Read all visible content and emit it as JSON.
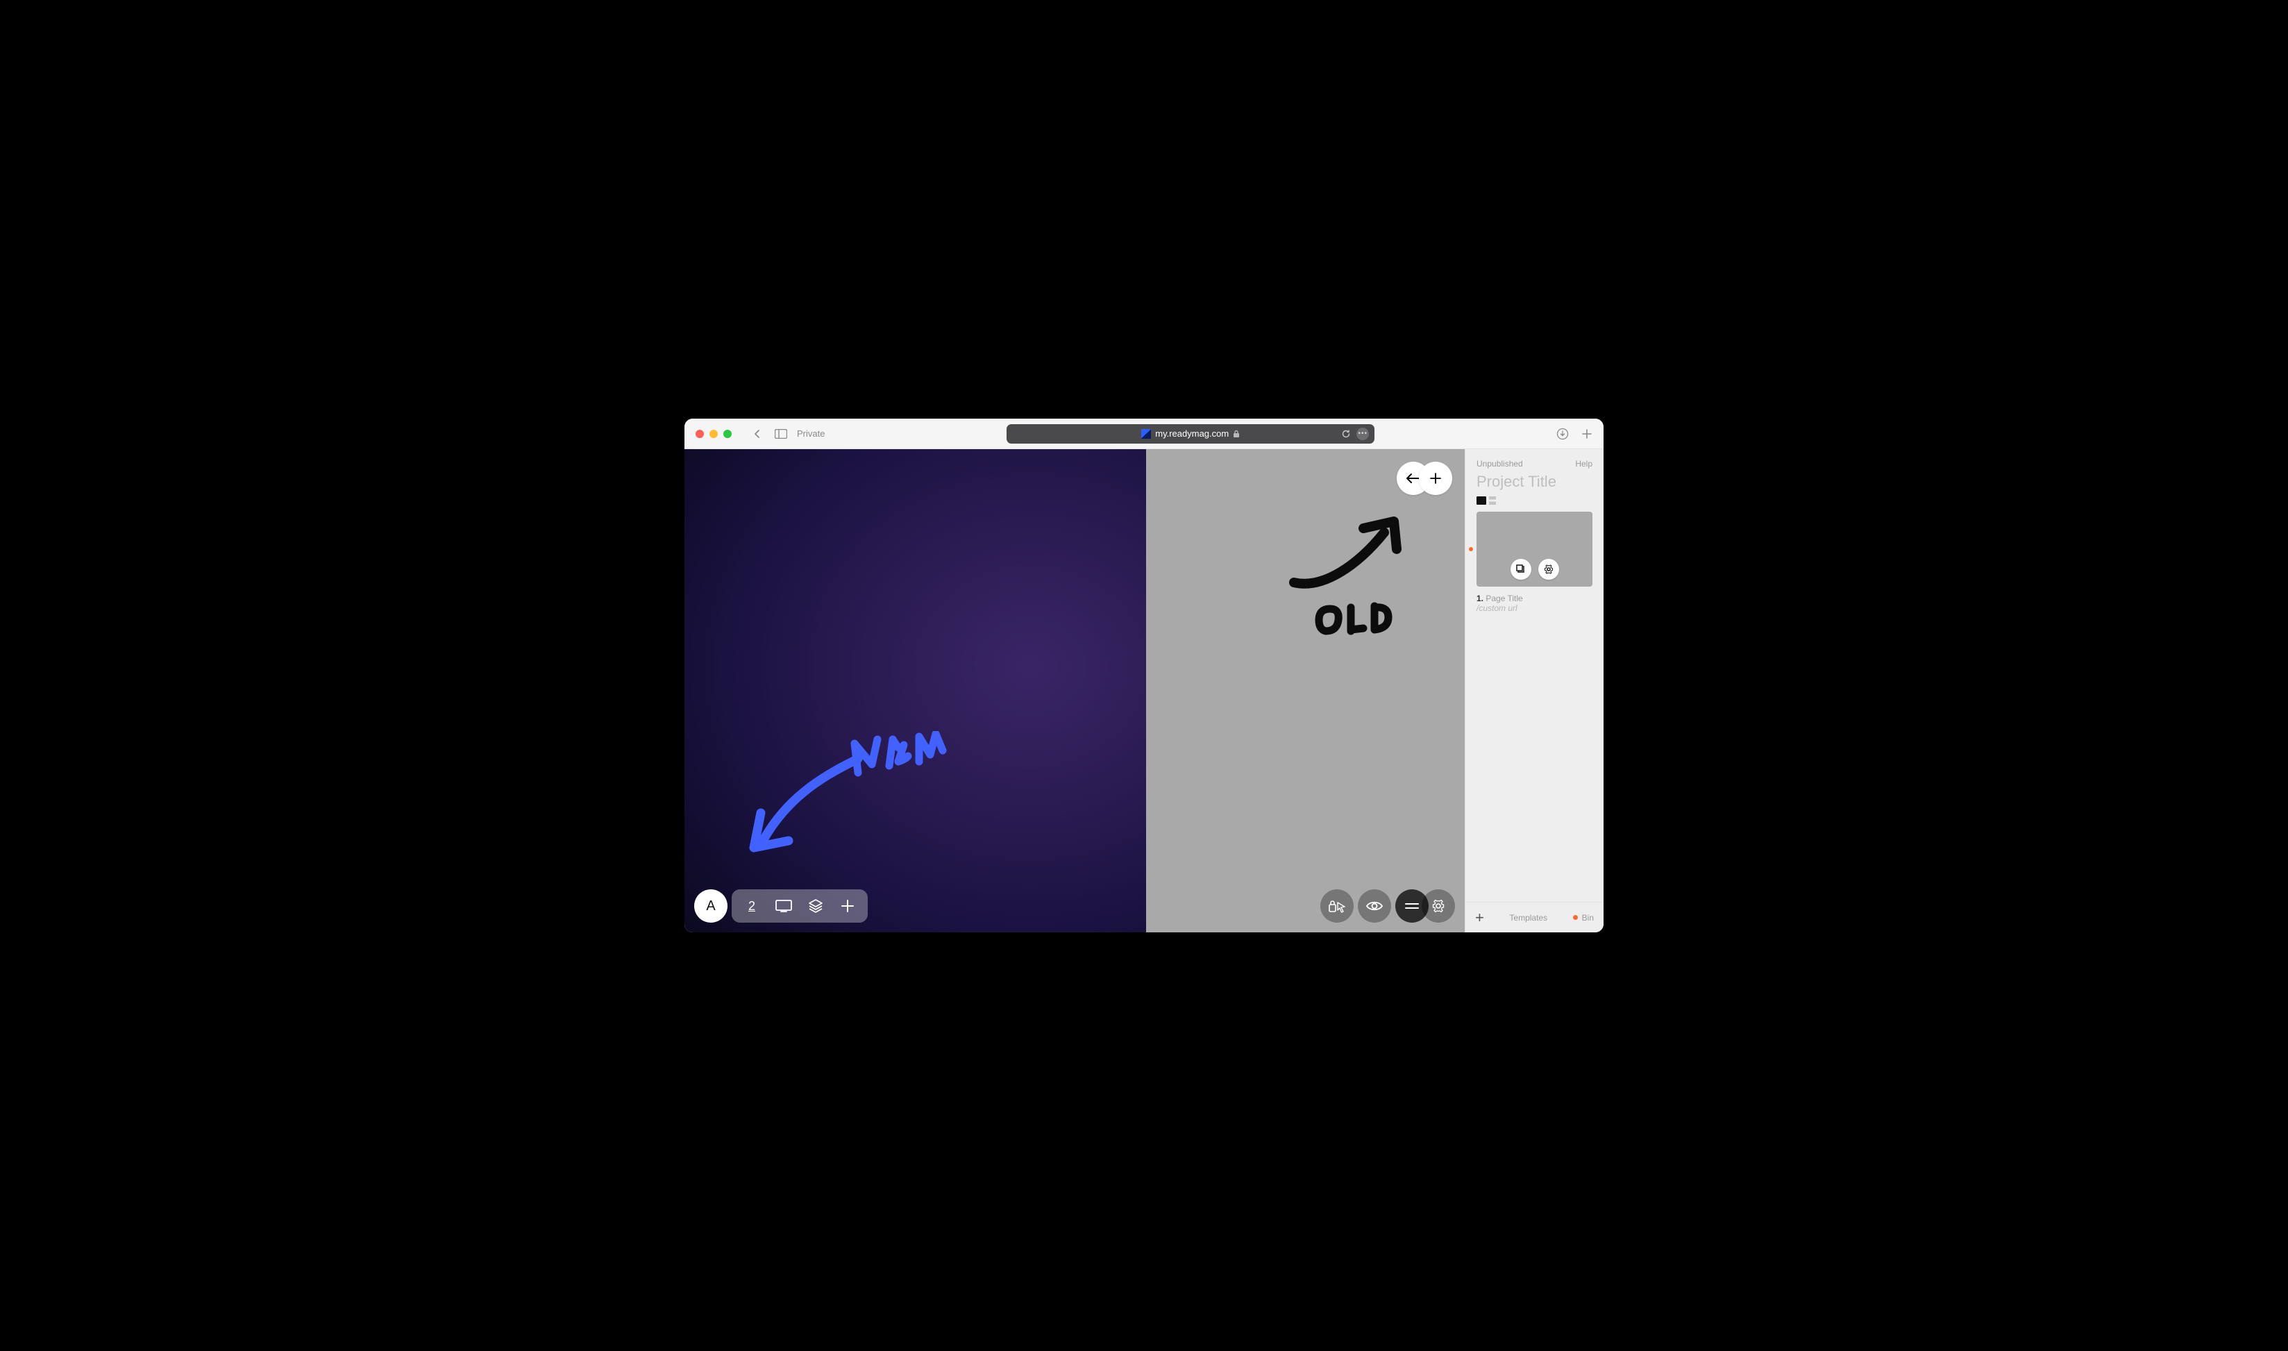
{
  "browser": {
    "private_label": "Private",
    "url": "my.readymag.com"
  },
  "annotations": {
    "new": "NEW",
    "old": "OLD"
  },
  "colors": {
    "annotation_new": "#4262ff",
    "annotation_old": "#0c0c0c",
    "accent_orange": "#ff6a2b",
    "canvas_gradient_dark": "#0d0a24",
    "canvas_gradient_purple": "#3a2566"
  },
  "bottom_left": {
    "avatar_letter": "A",
    "page_count": "2"
  },
  "right_panel": {
    "status": "Unpublished",
    "help": "Help",
    "project_title_placeholder": "Project Title",
    "page_number": "1.",
    "page_title_placeholder": "Page Title",
    "custom_url_placeholder": "/custom url",
    "templates_label": "Templates",
    "bin_label": "Bin"
  }
}
